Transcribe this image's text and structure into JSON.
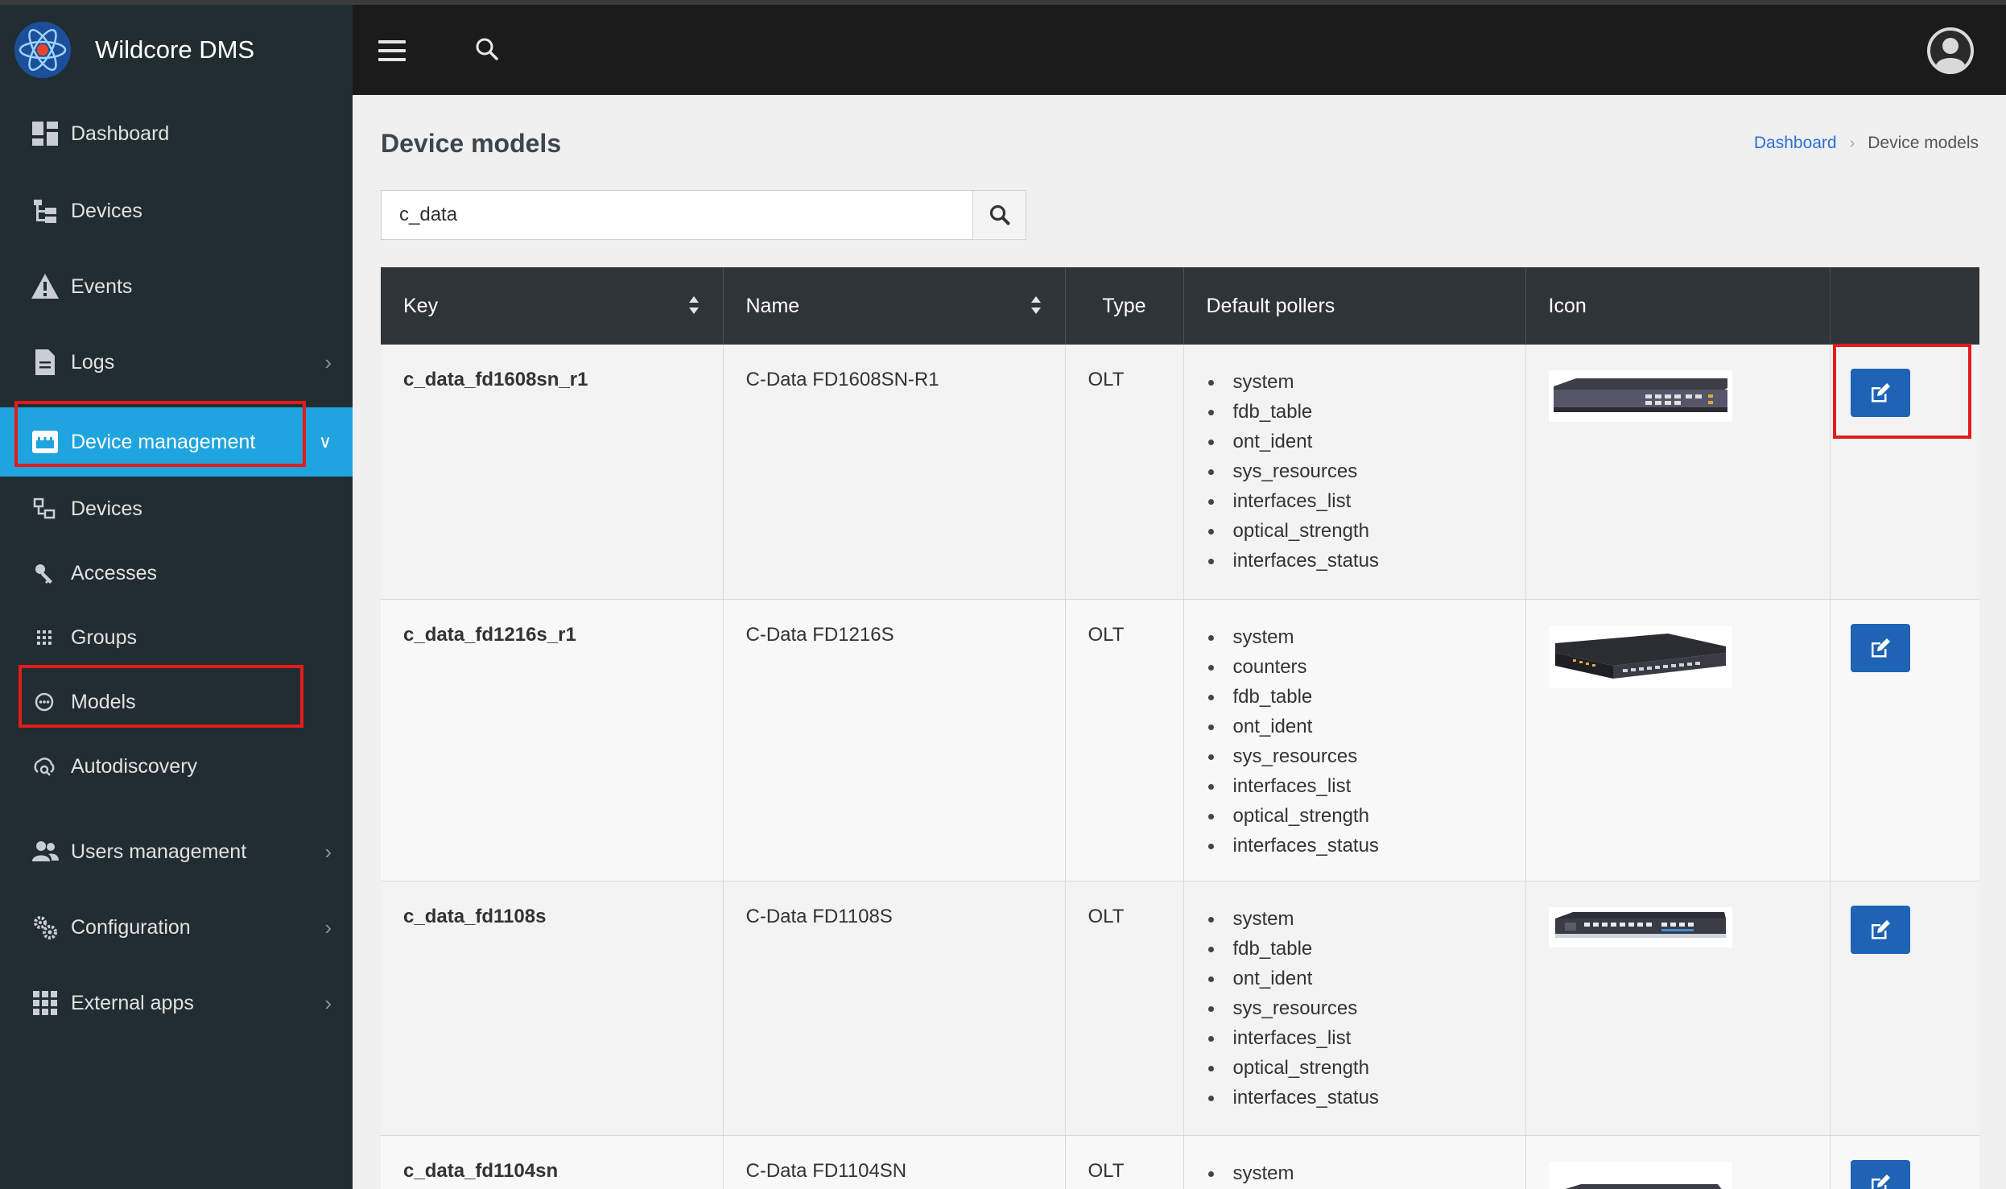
{
  "app": {
    "name": "Wildcore DMS"
  },
  "sidebar": {
    "items": [
      {
        "label": "Dashboard",
        "icon": "dashboard-icon"
      },
      {
        "label": "Devices",
        "icon": "tree-icon"
      },
      {
        "label": "Events",
        "icon": "warning-icon"
      },
      {
        "label": "Logs",
        "icon": "file-icon"
      },
      {
        "label": "Device management",
        "icon": "device-management-icon"
      }
    ],
    "subitems": [
      {
        "label": "Devices",
        "icon": "devices-icon"
      },
      {
        "label": "Accesses",
        "icon": "key-icon"
      },
      {
        "label": "Groups",
        "icon": "groups-icon"
      },
      {
        "label": "Models",
        "icon": "models-icon"
      },
      {
        "label": "Autodiscovery",
        "icon": "autodiscovery-icon"
      }
    ],
    "bottom": [
      {
        "label": "Users management",
        "icon": "users-icon"
      },
      {
        "label": "Configuration",
        "icon": "gears-icon"
      },
      {
        "label": "External apps",
        "icon": "apps-grid-icon"
      }
    ]
  },
  "page": {
    "title": "Device models",
    "breadcrumb": {
      "home": "Dashboard",
      "current": "Device models"
    }
  },
  "search": {
    "value": "c_data",
    "placeholder": ""
  },
  "table": {
    "columns": [
      "Key",
      "Name",
      "Type",
      "Default pollers",
      "Icon",
      ""
    ],
    "rows": [
      {
        "key": "c_data_fd1608sn_r1",
        "name": "C-Data FD1608SN-R1",
        "type": "OLT",
        "pollers": [
          "system",
          "fdb_table",
          "ont_ident",
          "sys_resources",
          "interfaces_list",
          "optical_strength",
          "interfaces_status"
        ]
      },
      {
        "key": "c_data_fd1216s_r1",
        "name": "C-Data FD1216S",
        "type": "OLT",
        "pollers": [
          "system",
          "counters",
          "fdb_table",
          "ont_ident",
          "sys_resources",
          "interfaces_list",
          "optical_strength",
          "interfaces_status"
        ]
      },
      {
        "key": "c_data_fd1108s",
        "name": "C-Data FD1108S",
        "type": "OLT",
        "pollers": [
          "system",
          "fdb_table",
          "ont_ident",
          "sys_resources",
          "interfaces_list",
          "optical_strength",
          "interfaces_status"
        ]
      },
      {
        "key": "c_data_fd1104sn",
        "name": "C-Data FD1104SN",
        "type": "OLT",
        "pollers": [
          "system"
        ]
      }
    ]
  },
  "colors": {
    "accent": "#1fa4e0",
    "sidebar": "#222d32",
    "topbar": "#1b1b1b",
    "edit_button": "#1f63b5",
    "highlight": "#e31b1b"
  }
}
